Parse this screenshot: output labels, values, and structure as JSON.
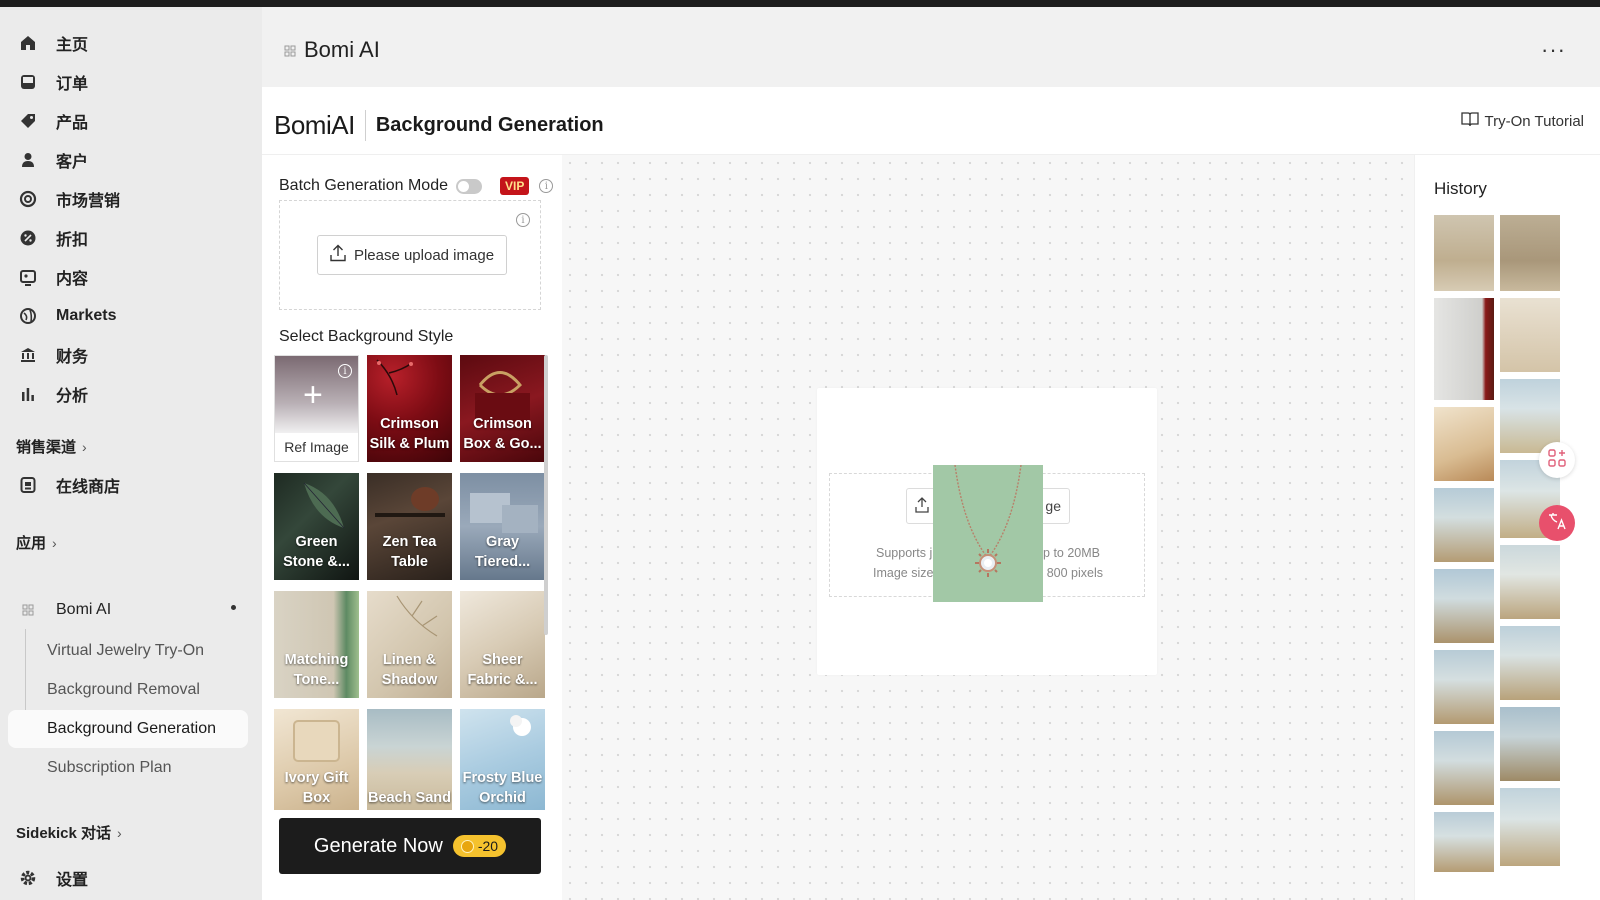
{
  "sidebar": {
    "nav": [
      {
        "label": "主页",
        "icon": "home-icon"
      },
      {
        "label": "订单",
        "icon": "inbox-icon"
      },
      {
        "label": "产品",
        "icon": "tag-icon"
      },
      {
        "label": "客户",
        "icon": "person-icon"
      },
      {
        "label": "市场营销",
        "icon": "target-icon"
      },
      {
        "label": "折扣",
        "icon": "discount-icon"
      },
      {
        "label": "内容",
        "icon": "image-icon"
      },
      {
        "label": "Markets",
        "icon": "globe-icon"
      },
      {
        "label": "财务",
        "icon": "bank-icon"
      },
      {
        "label": "分析",
        "icon": "bar-chart-icon"
      }
    ],
    "sales_channels_label": "销售渠道",
    "online_store_label": "在线商店",
    "apps_label": "应用",
    "app_name": "Bomi AI",
    "app_subitems": [
      "Virtual Jewelry Try-On",
      "Background Removal",
      "Background Generation",
      "Subscription Plan"
    ],
    "sidekick_label": "Sidekick 对话",
    "settings_label": "设置"
  },
  "app_header": {
    "title": "Bomi AI",
    "more": "···"
  },
  "page": {
    "brand": "BomiAI",
    "title": "Background Generation",
    "tutorial_label": "Try-On Tutorial"
  },
  "panel": {
    "batch_label": "Batch Generation Mode",
    "batch_enabled": false,
    "vip_badge": "VIP",
    "upload_label": "Please upload image",
    "select_style_label": "Select Background Style",
    "ref_image_label": "Ref Image",
    "styles": [
      "Crimson Silk & Plum",
      "Crimson Box & Go...",
      "Green Stone &...",
      "Zen Tea Table",
      "Gray Tiered...",
      "Matching Tone...",
      "Linen & Shadow",
      "Sheer Fabric &...",
      "Ivory Gift Box",
      "Beach Sand",
      "Frosty Blue Orchid"
    ],
    "generate_label": "Generate Now",
    "generate_cost": "-20"
  },
  "canvas": {
    "upload_partial": "ge",
    "supports_left": "Supports j",
    "supports_right": "p to 20MB",
    "size_left": "Image size",
    "size_right": "x 800 pixels"
  },
  "history": {
    "title": "History"
  },
  "colors": {
    "vip": "#c4141a",
    "accent": "#1c1c1c",
    "preview_bg": "#a2c8a6",
    "coin": "#f5c22e"
  }
}
